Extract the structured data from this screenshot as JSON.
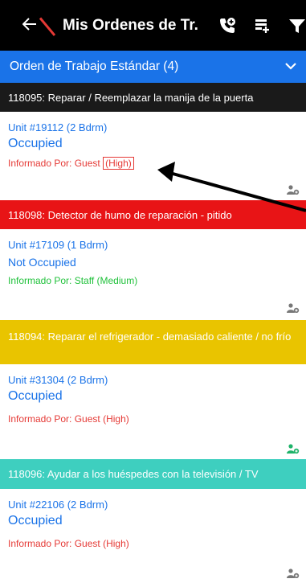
{
  "appbar": {
    "title": "Mis Ordenes de Tr..."
  },
  "section": {
    "title": "Orden de Trabajo Estándar (4)"
  },
  "orders": [
    {
      "header": "118095: Reparar / Reemplazar la manija de la puerta",
      "header_color": "#1a1a1a",
      "unit": "Unit #19112 (2 Bdrm)",
      "status": "Occupied",
      "reported_prefix": "Informado Por: Guest",
      "priority": "(High)",
      "reported_color": "#e53935",
      "icon_color": "#777777"
    },
    {
      "header": "118098: Detector de humo de reparación - pitido",
      "header_color": "#e81416",
      "unit": "Unit #17109 (1 Bdrm)",
      "status": "Not Occupied",
      "reported_prefix": "Informado Por: Staff",
      "priority": "(Medium)",
      "reported_color": "#1fc13a",
      "icon_color": "#777777"
    },
    {
      "header": "118094: Reparar el refrigerador - demasiado caliente / no frío",
      "header_color": "#e9c400",
      "unit": "Unit #31304 (2 Bdrm)",
      "status": "Occupied",
      "reported_prefix": "Informado Por: Guest",
      "priority": "(High)",
      "reported_color": "#e53935",
      "icon_color": "#1fb36a"
    },
    {
      "header": "118096: Ayudar a los huéspedes con la televisión / TV",
      "header_color": "#3ecfbf",
      "unit": "Unit #22106 (2 Bdrm)",
      "status": "Occupied",
      "reported_prefix": "Informado Por: Guest",
      "priority": "(High)",
      "reported_color": "#e53935",
      "icon_color": "#777777"
    }
  ],
  "colors": {
    "appbar": "#000000",
    "section": "#1a73e8",
    "link_blue": "#1a73e8"
  }
}
